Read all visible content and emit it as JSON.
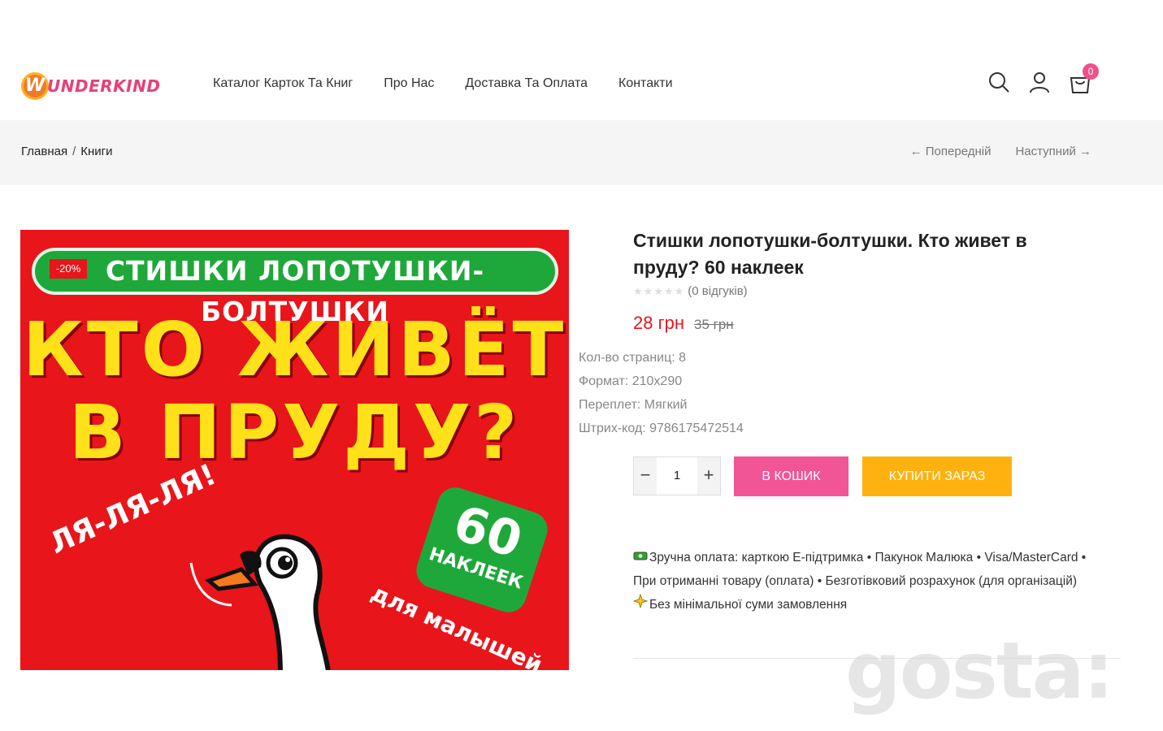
{
  "logo": {
    "mark": "W",
    "text": "UNDERKIND"
  },
  "nav": [
    {
      "label": "Каталог Карток Та Книг"
    },
    {
      "label": "Про Нас"
    },
    {
      "label": "Доставка Та Оплата"
    },
    {
      "label": "Контакти"
    }
  ],
  "header_icons": {
    "search": "search-icon",
    "account": "user-icon",
    "cart": "cart-icon",
    "cart_count": "0"
  },
  "breadcrumb": {
    "home": "Главная",
    "separator": "/",
    "current": "Книги"
  },
  "pager": {
    "prev": "← Попередній",
    "next": "Наступний →"
  },
  "product_image": {
    "sale_badge": "-20%",
    "band_title": "СТИШКИ ЛОПОТУШКИ-БОЛТУШКИ",
    "headline_1": "КТО ЖИВЁТ",
    "headline_2": "В ПРУДУ?",
    "callout": "ЛЯ-ЛЯ-ЛЯ!",
    "sticker_number": "60",
    "sticker_word": "НАКЛЕЕК",
    "kids_text": "для малышей"
  },
  "product": {
    "title": "Стишки лопотушки-болтушки. Кто живет в пруду? 60 наклеек",
    "stars": "★★★★★",
    "reviews": "(0 відгуків)",
    "price_new": "28 грн",
    "price_old": "35 грн",
    "attributes": [
      "Кол-во страниц: 8",
      "Формат: 210x290",
      "Переплет: Мягкий",
      "Штрих-код: 9786175472514"
    ],
    "qty_minus": "−",
    "qty_value": "1",
    "qty_plus": "+",
    "add_to_cart": "В КОШИК",
    "buy_now": "КУПИТИ ЗАРАЗ"
  },
  "payment": {
    "line1_icon": "money-icon",
    "line1": "Зручна оплата: карткою Е-підтримка • Пакунок Малюка • Visa/MasterCard • При отриманні товару (оплата) • Безготівковий розрахунок (для організацій)",
    "line2_icon": "sparkle-icon",
    "line2": "Без мінімальної суми замовлення"
  },
  "watermark": "gosta:",
  "colors": {
    "brand_pink": "#f25596",
    "buy_orange": "#ffb20f",
    "price_red": "#e8151b"
  }
}
